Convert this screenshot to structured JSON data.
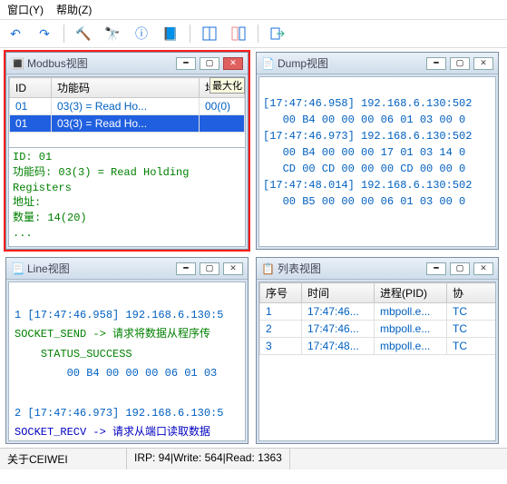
{
  "menubar": {
    "window": "窗口(Y)",
    "help": "帮助(Z)"
  },
  "toolbar_icons": [
    "undo-icon",
    "redo-icon",
    "hammer-icon",
    "binoculars-icon",
    "info-icon",
    "book-icon",
    "panels-icon",
    "panels2-icon",
    "exit-icon"
  ],
  "modbus": {
    "title": "Modbus视图",
    "cols": [
      "ID",
      "功能码",
      "地址"
    ],
    "maxtag": "最大化",
    "rows": [
      {
        "id": "01",
        "fc": "03(3) = Read Ho...",
        "addr": "00(0)"
      },
      {
        "id": "01",
        "fc": "03(3) = Read Ho...",
        "addr": ""
      }
    ],
    "info_id": "ID: 01",
    "info_fc": "功能码: 03(3) = Read Holding Registers",
    "info_addr": "地址:",
    "info_qty": "数量: 14(20)",
    "info_more": "..."
  },
  "dump": {
    "title": "Dump视图",
    "lines": [
      "[17:47:46.958] 192.168.6.130:502",
      "   00 B4 00 00 00 06 01 03 00 0",
      "[17:47:46.973] 192.168.6.130:502",
      "   00 B4 00 00 00 17 01 03 14 0",
      "   CD 00 CD 00 00 00 CD 00 00 0",
      "[17:47:48.014] 192.168.6.130:502",
      "   00 B5 00 00 00 06 01 03 00 0"
    ]
  },
  "line": {
    "title": "Line视图",
    "entries": [
      {
        "idx": "1",
        "ts": "[17:47:46.958] 192.168.6.130:5",
        "dir": "SOCKET_SEND -> 请求将数据从程序传",
        "status": "STATUS_SUCCESS",
        "hex": "00 B4 00 00 00 06 01 03"
      },
      {
        "idx": "2",
        "ts": "[17:47:46.973] 192.168.6.130:5",
        "dir": "SOCKET_RECV -> 请求从端口读取数据",
        "status": "",
        "hex": ""
      }
    ]
  },
  "list": {
    "title": "列表视图",
    "cols": [
      "序号",
      "时间",
      "进程(PID)",
      "协"
    ],
    "rows": [
      {
        "n": "1",
        "t": "17:47:46...",
        "p": "mbpoll.e...",
        "pr": "TC"
      },
      {
        "n": "2",
        "t": "17:47:46...",
        "p": "mbpoll.e...",
        "pr": "TC"
      },
      {
        "n": "3",
        "t": "17:47:48...",
        "p": "mbpoll.e...",
        "pr": "TC"
      }
    ]
  },
  "status": {
    "about": "关于CEIWEI",
    "irp": "IRP: 94",
    "write": "Write: 564",
    "read": "Read: 1363"
  }
}
